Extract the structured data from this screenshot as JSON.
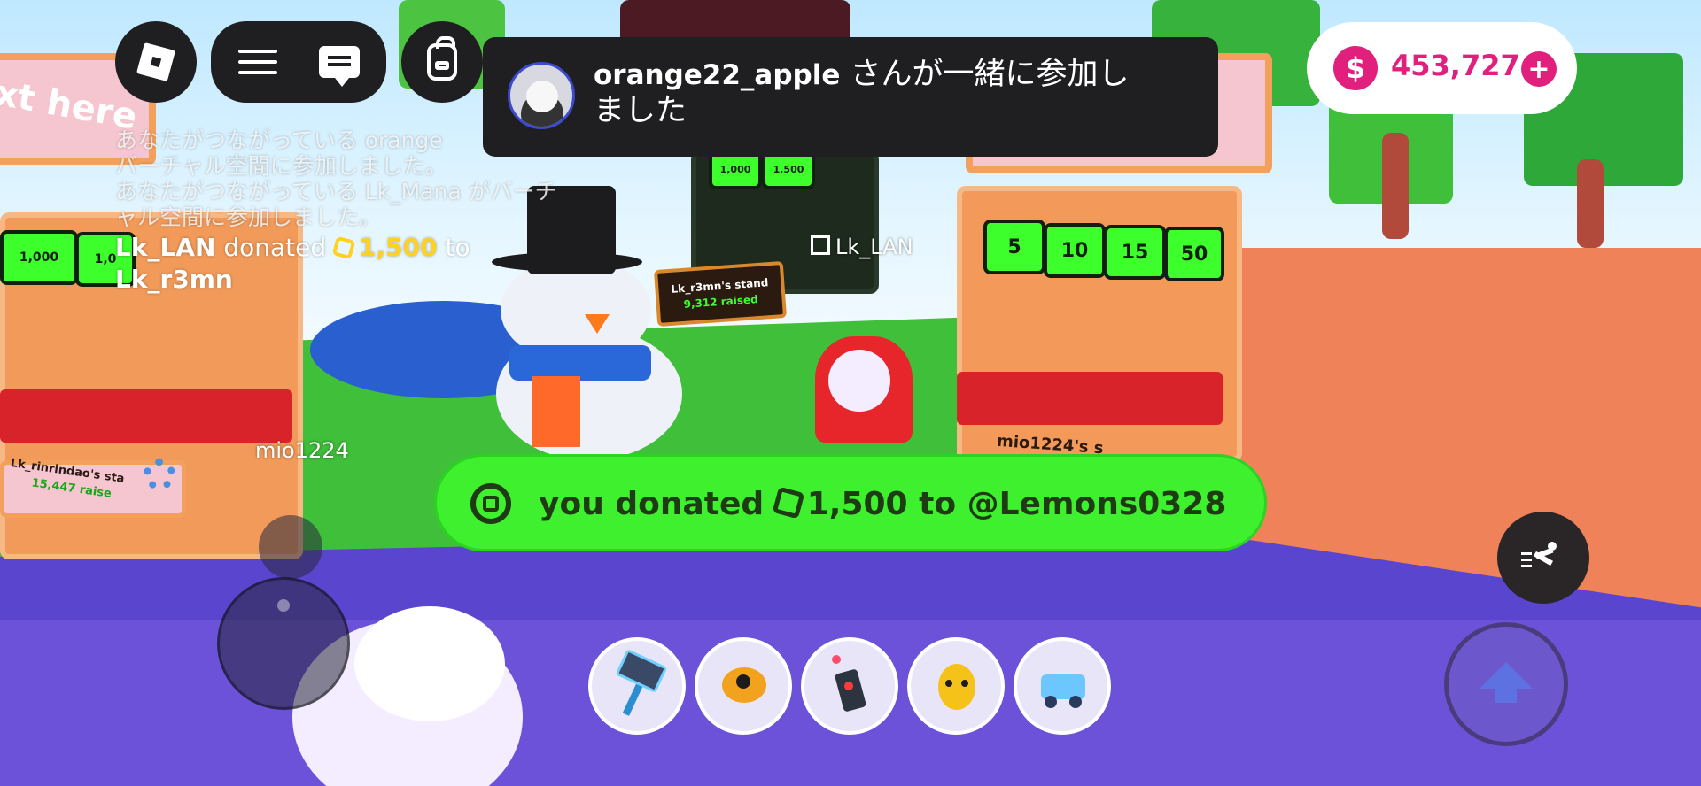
{
  "top_bar": {
    "roblox_menu_icon": "roblox-logo-icon",
    "hamburger_icon": "hamburger-icon",
    "chat_icon": "chat-icon",
    "backpack_icon": "backpack-icon"
  },
  "notification": {
    "username": "orange22_apple",
    "message_line1": " さんが一緒に参加し",
    "message_line2": "ました"
  },
  "currency": {
    "icon_label": "$",
    "value": "453,727",
    "plus_label": "+"
  },
  "chat": {
    "lines": [
      "あなたがつながっている orange",
      "バーチャル空間に参加しました。",
      "あなたがつながっている Lk_Mana がバーチ",
      "ャル空間に参加しました。"
    ],
    "donation": {
      "sender": "Lk_LAN",
      "action": " donated ",
      "amount": "1,500",
      "to_word": " to",
      "recipient": "Lk_r3mn"
    }
  },
  "world_labels": {
    "player_tag_1": "Lk_LAN",
    "player_tag_2": "mio1224",
    "stand_sign_title": "Lk_r3mn's stand",
    "stand_sign_raised": "9,312 raised",
    "left_stand_title": "Lk_rinrindao's sta",
    "left_stand_raised": "15,447 raise",
    "right_stand_name": "mio1224's s",
    "sign_left_text": "xt here",
    "tiles_right": [
      "5",
      "10",
      "15",
      "50"
    ],
    "tiles_left": [
      "1,000",
      "1,0"
    ],
    "tiles_center": [
      "1,000",
      "1,500"
    ]
  },
  "donation_banner": {
    "prefix": "you donated ",
    "amount": "1,500",
    "suffix": " to @Lemons0328"
  },
  "hotbar": {
    "slots": [
      "hammer-tool-icon",
      "rocket-fish-tool-icon",
      "remote-control-tool-icon",
      "pet-egg-tool-icon",
      "cart-tool-icon"
    ]
  },
  "controls": {
    "sprint_icon": "running-person-icon",
    "jump_icon": "jump-arrow-icon"
  },
  "colors": {
    "robux_pink": "#e0207c",
    "donate_green": "#3ff02f",
    "panel_dark": "#1f1f22",
    "coin_yellow": "#ffd21f"
  }
}
